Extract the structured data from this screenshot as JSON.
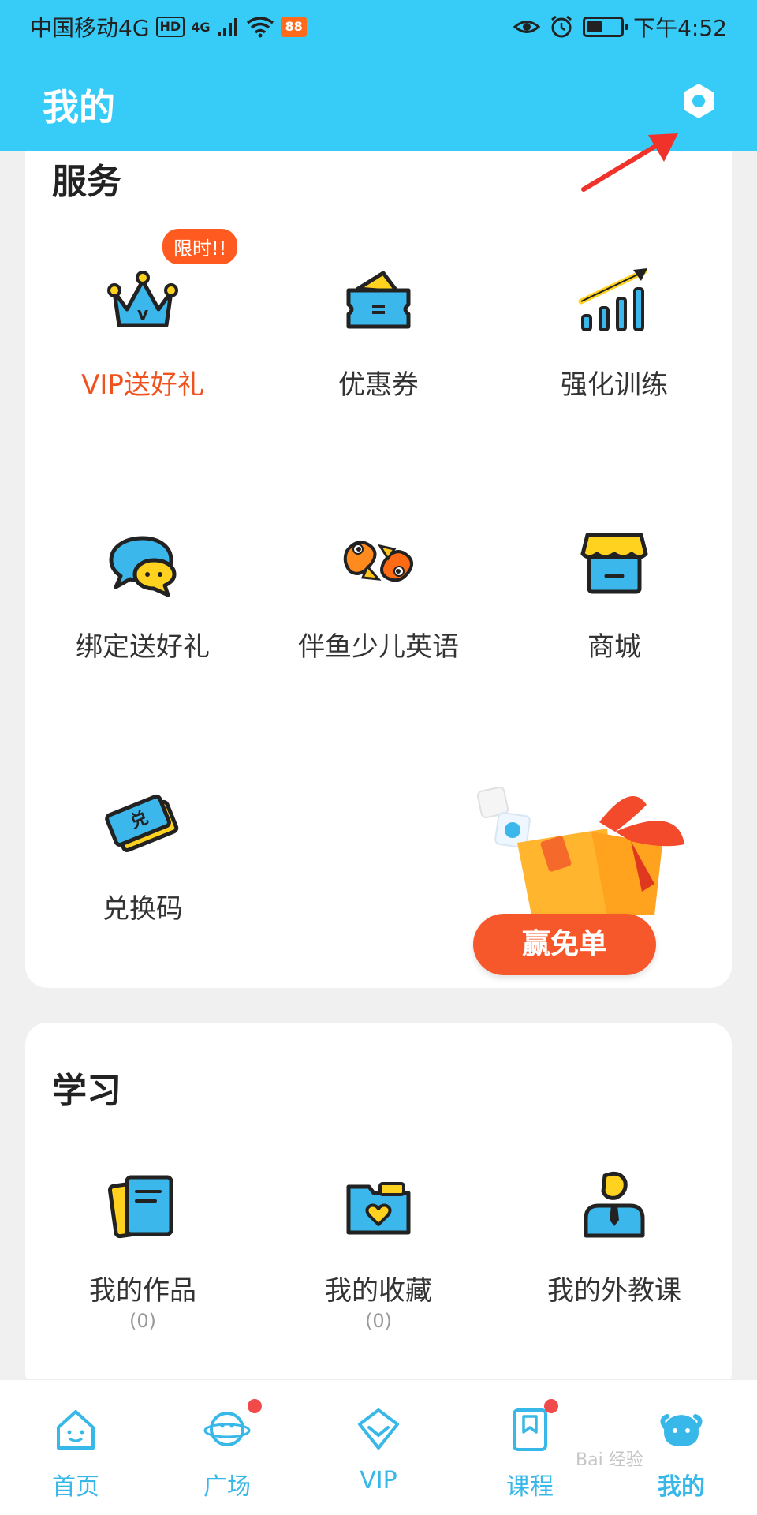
{
  "status_bar": {
    "carrier": "中国移动4G",
    "hd": "HD",
    "network": "4G",
    "app_badge": "88",
    "time": "下午4:52"
  },
  "header": {
    "title": "我的",
    "settings_icon": "gear-icon"
  },
  "services": {
    "title": "服务",
    "limited_badge": "限时!!",
    "items": [
      {
        "label": "VIP送好礼",
        "icon": "crown-icon",
        "highlight": true
      },
      {
        "label": "优惠券",
        "icon": "wallet-coupon-icon"
      },
      {
        "label": "强化训练",
        "icon": "bar-chart-icon"
      },
      {
        "label": "绑定送好礼",
        "icon": "chat-bubbles-icon"
      },
      {
        "label": "伴鱼少儿英语",
        "icon": "goldfish-icon"
      },
      {
        "label": "商城",
        "icon": "shop-icon"
      },
      {
        "label": "兑换码",
        "icon": "ticket-icon"
      }
    ],
    "promo": {
      "label": "赢免单",
      "icon": "gift-box-icon"
    }
  },
  "study": {
    "title": "学习",
    "items": [
      {
        "label": "我的作品",
        "count": "(0)",
        "icon": "notebook-icon"
      },
      {
        "label": "我的收藏",
        "count": "(0)",
        "icon": "folder-heart-icon"
      },
      {
        "label": "我的外教课",
        "icon": "teacher-icon"
      }
    ]
  },
  "bottom_nav": {
    "items": [
      {
        "label": "首页",
        "icon": "home-icon"
      },
      {
        "label": "广场",
        "icon": "planet-icon",
        "has_dot": true
      },
      {
        "label": "VIP",
        "icon": "diamond-icon"
      },
      {
        "label": "课程",
        "icon": "bookmark-book-icon",
        "has_dot": true
      },
      {
        "label": "我的",
        "icon": "profile-face-icon",
        "active": true
      }
    ]
  },
  "watermark": "Bai 经验",
  "colors": {
    "header": "#37cbf8",
    "accent_orange": "#f0521e",
    "nav_blue": "#38b8e8",
    "badge_red": "#f04a4a"
  }
}
